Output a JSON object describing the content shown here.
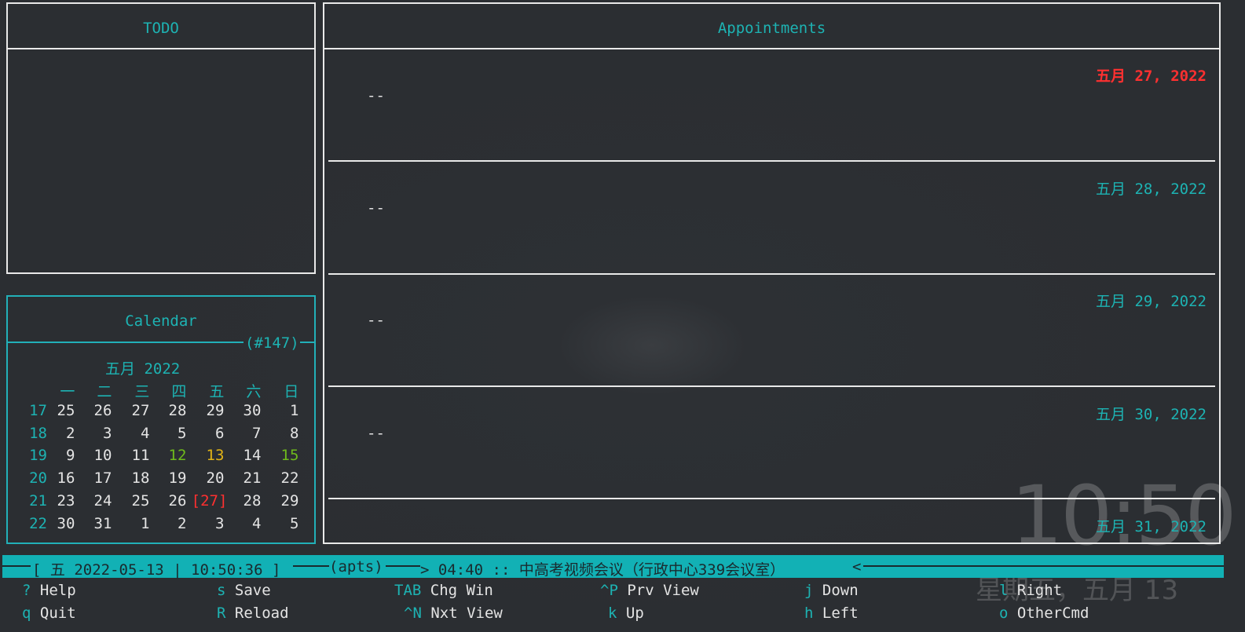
{
  "colors": {
    "accent": "#1db3b3",
    "today": "#ff3030",
    "weekend_highlight": "#6fba1c",
    "highlight_yellow": "#e2b416",
    "statusbar_bg": "#12b1b5"
  },
  "todo": {
    "title": "TODO"
  },
  "appointments": {
    "title": "Appointments",
    "days": [
      {
        "date": "五月 27, 2022",
        "entry": "--",
        "is_today": true
      },
      {
        "date": "五月 28, 2022",
        "entry": "--",
        "is_today": false
      },
      {
        "date": "五月 29, 2022",
        "entry": "--",
        "is_today": false
      },
      {
        "date": "五月 30, 2022",
        "entry": "--",
        "is_today": false
      },
      {
        "date": "五月 31, 2022",
        "entry": "",
        "is_today": false
      }
    ]
  },
  "calendar": {
    "title": "Calendar",
    "day_of_year": "(#147)",
    "month_label": "五月 2022",
    "weekday_headers": [
      "一",
      "二",
      "三",
      "四",
      "五",
      "六",
      "日"
    ],
    "weeks": [
      {
        "wk": "17",
        "days": [
          "25",
          "26",
          "27",
          "28",
          "29",
          "30",
          "1"
        ]
      },
      {
        "wk": "18",
        "days": [
          "2",
          "3",
          "4",
          "5",
          "6",
          "7",
          "8"
        ]
      },
      {
        "wk": "19",
        "days": [
          "9",
          "10",
          "11",
          "12",
          "13",
          "14",
          "15"
        ]
      },
      {
        "wk": "20",
        "days": [
          "16",
          "17",
          "18",
          "19",
          "20",
          "21",
          "22"
        ]
      },
      {
        "wk": "21",
        "days": [
          "23",
          "24",
          "25",
          "26",
          "[27]",
          "28",
          "29"
        ]
      },
      {
        "wk": "22",
        "days": [
          "30",
          "31",
          "1",
          "2",
          "3",
          "4",
          "5"
        ]
      }
    ]
  },
  "statusbar": {
    "datetime": "[ 五 2022-05-13 | 10:50:36 ]",
    "mode": "(apts)",
    "next_appointment": "> 04:40 :: 中高考视频会议（行政中心339会议室）",
    "end_marker": "<"
  },
  "keybindings": [
    {
      "key": "?",
      "label": "Help"
    },
    {
      "key": "s",
      "label": "Save"
    },
    {
      "key": "TAB",
      "label": "Chg Win"
    },
    {
      "key": "^P",
      "label": "Prv View"
    },
    {
      "key": "j",
      "label": "Down"
    },
    {
      "key": "l",
      "label": "Right"
    },
    {
      "key": "q",
      "label": "Quit"
    },
    {
      "key": "R",
      "label": "Reload"
    },
    {
      "key": "^N",
      "label": "Nxt View"
    },
    {
      "key": "k",
      "label": "Up"
    },
    {
      "key": "h",
      "label": "Left"
    },
    {
      "key": "o",
      "label": "OtherCmd"
    }
  ],
  "desktop_clock": {
    "time": "10:50",
    "date": "星期五，五月 13"
  }
}
